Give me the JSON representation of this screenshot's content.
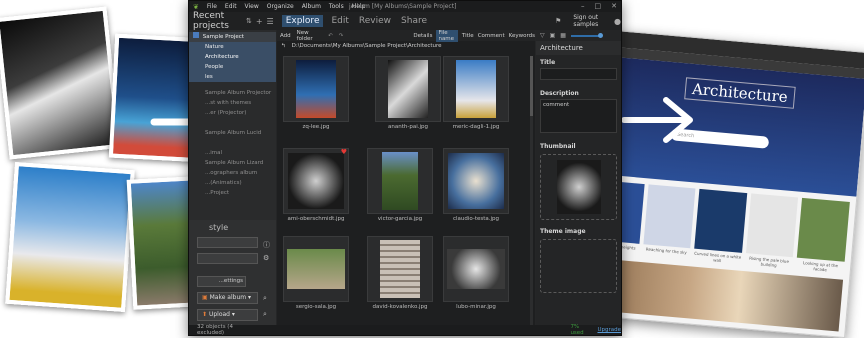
{
  "menu": {
    "items": [
      "File",
      "Edit",
      "View",
      "Organize",
      "Album",
      "Tools",
      "Help"
    ],
    "window_title": "jAlbum [My Albums\\Sample Project]",
    "sign_out": "Sign out samples"
  },
  "toolbar": {
    "recent_projects": "Recent projects",
    "tab_explore": "Explore",
    "tab_edit": "Edit",
    "tab_review": "Review",
    "tab_share": "Share"
  },
  "actions": {
    "add": "Add",
    "new_folder": "New folder",
    "details": "Details",
    "file_name": "File name",
    "title": "Title",
    "comment": "Comment",
    "keywords": "Keywords"
  },
  "path": "D:\\Documents\\My Albums\\Sample Project\\Architecture",
  "sidebar": {
    "items": [
      {
        "label": "Sample Project",
        "selected": false
      },
      {
        "label": "Nature",
        "selected": false
      },
      {
        "label": "Architecture",
        "selected": true
      },
      {
        "label": "People",
        "selected": false
      },
      {
        "label": "les",
        "selected": false
      },
      {
        "label": "Sample Album Projector",
        "selected": false
      },
      {
        "label": "...st with themes",
        "selected": false
      },
      {
        "label": "...er (Projector)",
        "selected": false
      },
      {
        "label": "",
        "selected": false
      },
      {
        "label": "Sample Album Lucid",
        "selected": false
      },
      {
        "label": "",
        "selected": false
      },
      {
        "label": "...imal",
        "selected": false
      },
      {
        "label": "Sample Album Lizard",
        "selected": false
      },
      {
        "label": "...ographers album",
        "selected": false
      },
      {
        "label": "...(Animatics)",
        "selected": false
      },
      {
        "label": "...Project",
        "selected": false
      }
    ],
    "style_label": "style",
    "settings_label": "...ettings",
    "make_album": "Make album",
    "upload": "Upload"
  },
  "thumbnails": [
    {
      "name": "zq-lee.jpg"
    },
    {
      "name": "ananth-pai.jpg"
    },
    {
      "name": "meric-dagli-1.jpg"
    },
    {
      "name": "ami-oberschmidt.jpg"
    },
    {
      "name": "victor-garcia.jpg"
    },
    {
      "name": "claudio-testa.jpg"
    },
    {
      "name": "sergio-sala.jpg"
    },
    {
      "name": "david-kovalenko.jpg"
    },
    {
      "name": "lubo-minar.jpg"
    }
  ],
  "right_panel": {
    "header": "Architecture",
    "title_label": "Title",
    "description_label": "Description",
    "comment_label": "comment",
    "thumbnail_label": "Thumbnail",
    "theme_image_label": "Theme image"
  },
  "status": {
    "objects": "32 objects (4 excluded)",
    "usage": "7% used",
    "upgrade": "Upgrade"
  },
  "browser": {
    "heading": "Architecture",
    "search_placeholder": "Search",
    "captions": [
      "Rising to the heights",
      "Reaching for the sky",
      "Curved lines on a white wall",
      "Rising the pale blue building",
      "Looking up at the facade"
    ]
  },
  "colors": {
    "accent": "#2f6da8",
    "app_bg": "#252627",
    "selection": "#3a4e66",
    "upgrade": "#5a9bd6",
    "usage_green": "#3c9a3c"
  }
}
